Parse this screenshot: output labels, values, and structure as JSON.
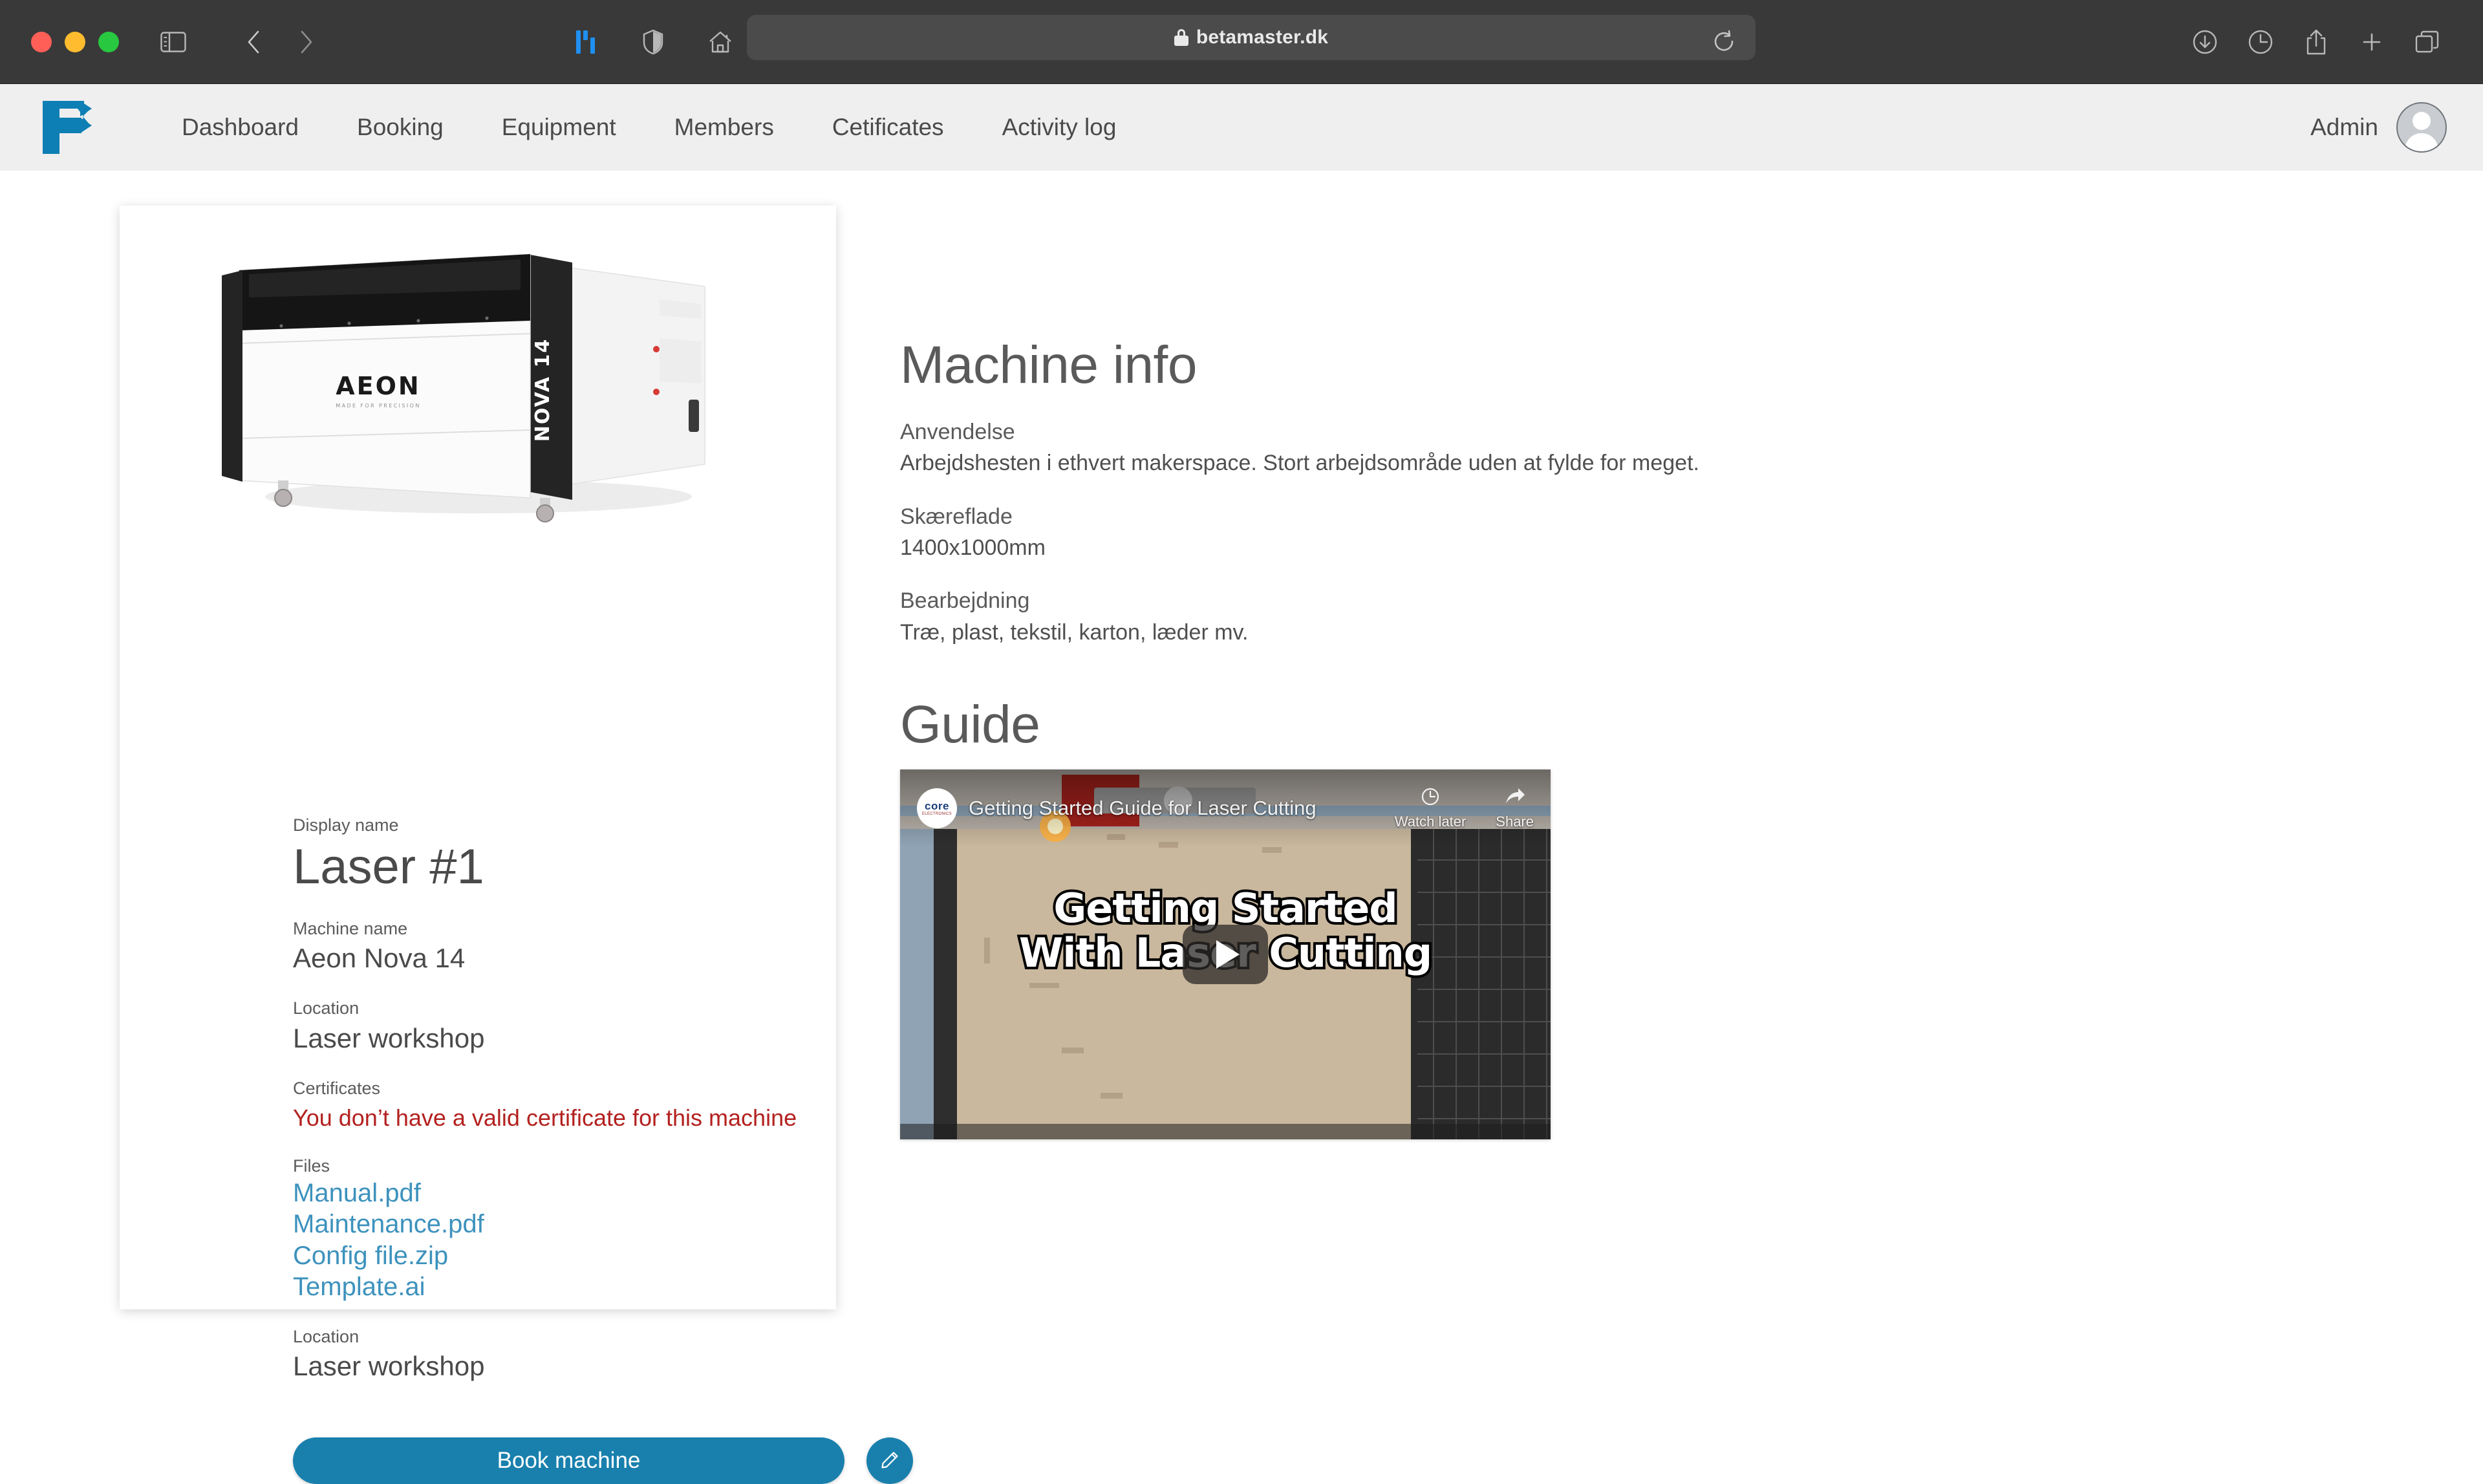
{
  "browser": {
    "url": "betamaster.dk",
    "lock_icon": "lock-icon",
    "toolbar_icons": {
      "sidebar": "sidebar-toggle-icon",
      "back": "back-arrow-icon",
      "forward": "forward-arrow-icon",
      "extension": "extension-icon",
      "shield": "privacy-shield-icon",
      "home": "home-icon",
      "reload": "reload-icon",
      "downloads": "downloads-icon",
      "history": "history-clock-icon",
      "share": "share-icon",
      "new_tab": "plus-icon",
      "tab_overview": "tab-overview-icon"
    }
  },
  "header": {
    "logo": "fb-logo",
    "nav": [
      {
        "label": "Dashboard"
      },
      {
        "label": "Booking"
      },
      {
        "label": "Equipment"
      },
      {
        "label": "Members"
      },
      {
        "label": "Cetificates"
      },
      {
        "label": "Activity log"
      }
    ],
    "user": {
      "name": "Admin",
      "avatar_icon": "user-avatar-icon"
    }
  },
  "machine_card": {
    "photo_alt": "AEON NOVA 14 laser cutter",
    "photo_brand": "AEON",
    "photo_brand_tagline": "MADE FOR PRECISION",
    "photo_model": "NOVA 14",
    "display_name_label": "Display name",
    "display_name": "Laser #1",
    "machine_name_label": "Machine name",
    "machine_name": "Aeon Nova 14",
    "location_label": "Location",
    "location": "Laser workshop",
    "certificates_label": "Certificates",
    "certificate_warning": "You don’t have a valid certificate for this machine",
    "files_label": "Files",
    "files": [
      {
        "name": "Manual.pdf"
      },
      {
        "name": "Maintenance.pdf"
      },
      {
        "name": "Config file.zip"
      },
      {
        "name": "Template.ai"
      }
    ],
    "location2_label": "Location",
    "location2": "Laser workshop",
    "book_button": "Book machine",
    "edit_button_icon": "pencil-edit-icon"
  },
  "machine_info": {
    "title": "Machine info",
    "groups": [
      {
        "label": "Anvendelse",
        "text": "Arbejdshesten i ethvert makerspace. Stort arbejdsområde uden at fylde for meget."
      },
      {
        "label": "Skæreflade",
        "text": "1400x1000mm"
      },
      {
        "label": "Bearbejdning",
        "text": "Træ, plast, tekstil, karton, læder mv."
      }
    ]
  },
  "guide": {
    "title": "Guide",
    "video": {
      "title": "Getting Started Guide for Laser Cutting",
      "channel": "core",
      "channel_sub": "ELECTRONICS",
      "watch_later": "Watch later",
      "share": "Share",
      "play_icon": "play-button-icon",
      "thumbnail_line1": "Getting Started",
      "thumbnail_line2": "With Laser Cutting"
    }
  },
  "colors": {
    "brand_blue": "#1980ad",
    "link_blue": "#3d92bd",
    "error_red": "#b3211f",
    "header_bg": "#efefef",
    "chrome_bg": "#393939"
  }
}
